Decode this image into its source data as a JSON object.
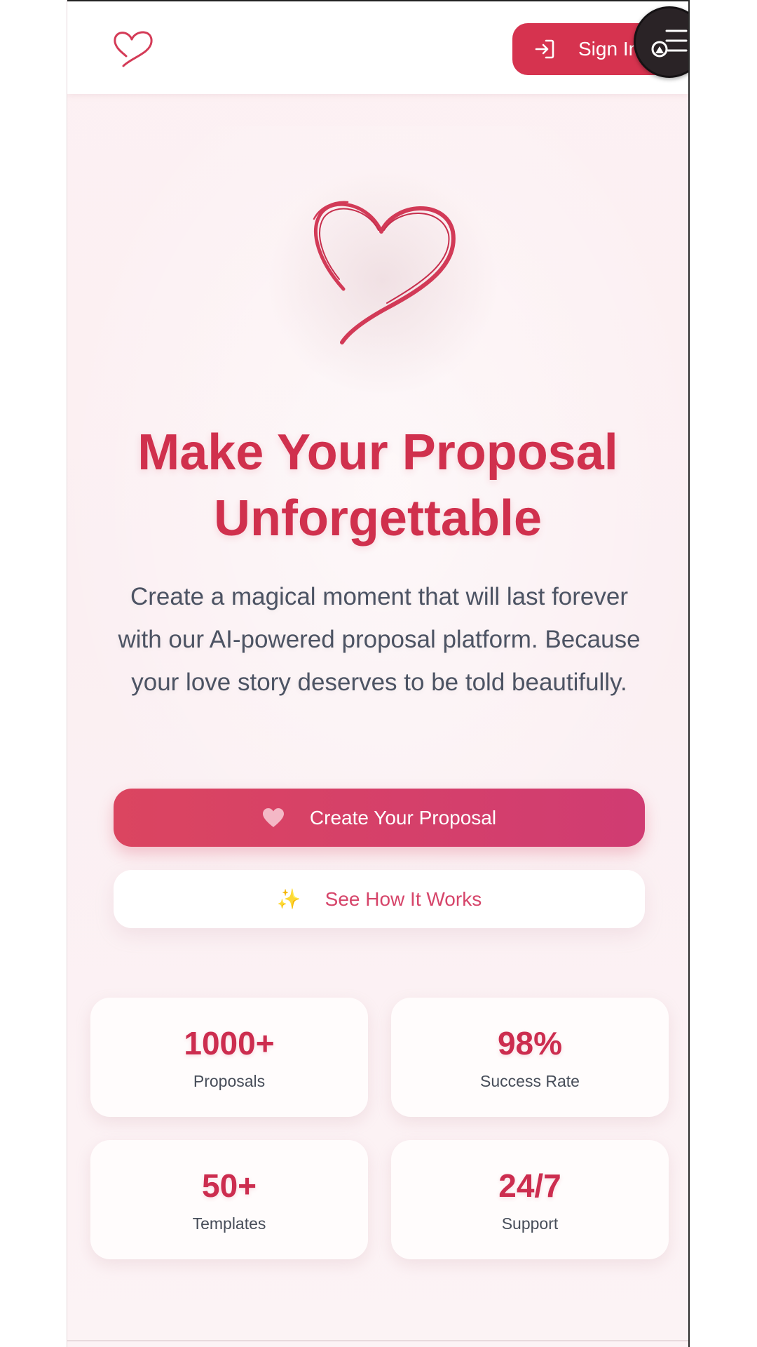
{
  "header": {
    "signin_label": "Sign In",
    "icons": {
      "logo": "heart-outline-icon",
      "signin": "sign-in-arrow-icon",
      "menu": "menu-lines-icon"
    }
  },
  "hero": {
    "title_line1": "Make Your Proposal",
    "title_line2": "Unforgettable",
    "subtitle": "Create a magical moment that will last forever with our AI-powered proposal platform. Because your love story deserves to be told beautifully.",
    "primary_button": "Create Your Proposal",
    "secondary_button": "See How It Works",
    "sparkle": "✨"
  },
  "stats": [
    {
      "value": "1000+",
      "label": "Proposals"
    },
    {
      "value": "98%",
      "label": "Success Rate"
    },
    {
      "value": "50+",
      "label": "Templates"
    },
    {
      "value": "24/7",
      "label": "Support"
    }
  ],
  "colors": {
    "brand": "#d0304d",
    "accent_pink": "#d6456a",
    "text_body": "#4c5363",
    "background": "#fdf1f3"
  }
}
